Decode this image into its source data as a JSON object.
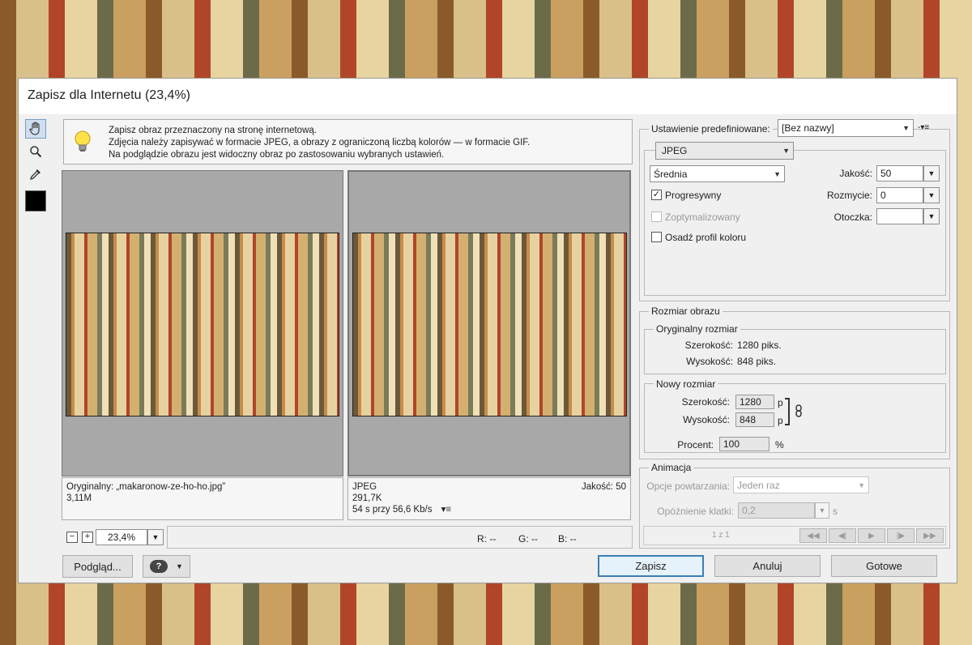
{
  "dialog": {
    "title": "Zapisz dla Internetu (23,4%)"
  },
  "tools": {
    "hand_icon": "hand-icon",
    "zoom_icon": "magnifier-icon",
    "eyedropper_icon": "eyedropper-icon",
    "swatch_color": "#000000"
  },
  "info": {
    "line1": "Zapisz obraz przeznaczony na stronę internetową.",
    "line2": "Zdjęcia należy zapisywać w formacie JPEG, a obrazy z ograniczoną liczbą kolorów — w formacie GIF.",
    "line3": "Na podglądzie obrazu jest widoczny obraz po zastosowaniu wybranych ustawień."
  },
  "original_pane": {
    "line1": "Oryginalny: „makaronow-ze-ho-ho.jpg”",
    "line2": "3,11M"
  },
  "optimized_pane": {
    "format": "JPEG",
    "quality": "Jakość: 50",
    "size": "291,7K",
    "time": "54 s przy 56,6 Kb/s"
  },
  "statusbar": {
    "zoom": "23,4%",
    "r": "R: --",
    "g": "G: --",
    "b": "B: --"
  },
  "settings": {
    "preset_label": "Ustawienie predefiniowane:",
    "preset_value": "[Bez nazwy]",
    "format": "JPEG",
    "quality_level": "Średnia",
    "progressive": "Progresywny",
    "optimized": "Zoptymalizowany",
    "embed_profile": "Osadź profil koloru",
    "quality_label": "Jakość:",
    "quality_value": "50",
    "blur_label": "Rozmycie:",
    "blur_value": "0",
    "matte_label": "Otoczka:",
    "matte_value": ""
  },
  "image_size": {
    "group": "Rozmiar obrazu",
    "original_group": "Oryginalny rozmiar",
    "width_label": "Szerokość:",
    "width_value": "1280 piks.",
    "height_label": "Wysokość:",
    "height_value": "848 piks.",
    "new_group": "Nowy rozmiar",
    "new_width_label": "Szerokość:",
    "new_width": "1280",
    "new_height_label": "Wysokość:",
    "new_height": "848",
    "unit_p": "p",
    "percent_label": "Procent:",
    "percent_value": "100",
    "percent_unit": "%"
  },
  "animation": {
    "group": "Animacja",
    "loop_label": "Opcje powtarzania:",
    "loop_value": "Jeden raz",
    "delay_label": "Opóźnienie klatki:",
    "delay_value": "0,2",
    "delay_unit": "s",
    "frame_counter": "1 z 1"
  },
  "buttons": {
    "preview": "Podgląd...",
    "save": "Zapisz",
    "cancel": "Anuluj",
    "done": "Gotowe"
  }
}
